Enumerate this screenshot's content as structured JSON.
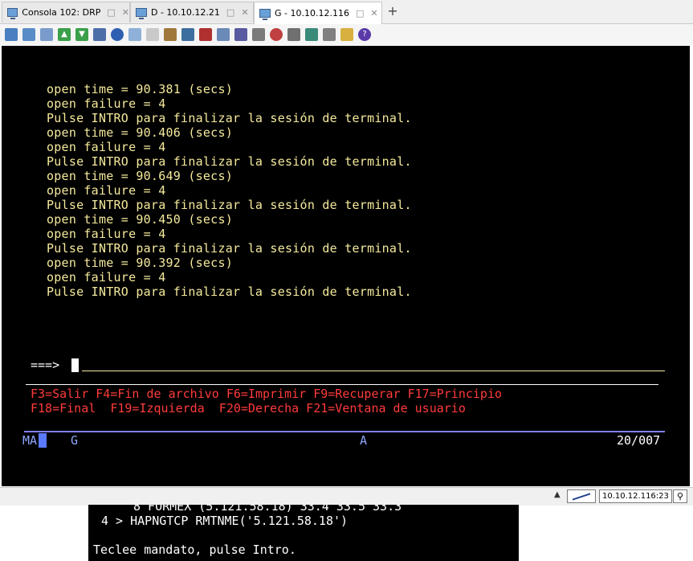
{
  "tabs": [
    {
      "label": "Consola 102: DRP",
      "active": false
    },
    {
      "label": "D - 10.10.12.21",
      "active": false
    },
    {
      "label": "G - 10.10.12.116",
      "active": true
    }
  ],
  "tab_controls": {
    "restore": "□",
    "close": "✕",
    "add": "+"
  },
  "toolbar_icons": [
    "copy-icon",
    "paste-icon",
    "clipboard-icon",
    "upload-icon",
    "download-icon",
    "disk-icon",
    "navigator-icon",
    "window-icon",
    "notes-icon",
    "package-icon",
    "settings-icon",
    "spool-icon",
    "mail-icon",
    "grid-icon",
    "macro-icon",
    "record-icon",
    "stop-icon",
    "play-icon",
    "pause-icon",
    "edit-icon",
    "help-icon"
  ],
  "terminal": {
    "lines": [
      "open time = 90.381 (secs)",
      "open failure = 4",
      "Pulse INTRO para finalizar la sesión de terminal.",
      "open time = 90.406 (secs)",
      "open failure = 4",
      "Pulse INTRO para finalizar la sesión de terminal.",
      "open time = 90.649 (secs)",
      "open failure = 4",
      "Pulse INTRO para finalizar la sesión de terminal.",
      "open time = 90.450 (secs)",
      "open failure = 4",
      "Pulse INTRO para finalizar la sesión de terminal.",
      "open time = 90.392 (secs)",
      "open failure = 4",
      "Pulse INTRO para finalizar la sesión de terminal."
    ],
    "prompt": "===>",
    "command_value": "",
    "fkeys_line1": "F3=Salir F4=Fin de archivo F6=Imprimir F9=Recuperar F17=Principio",
    "fkeys_line2": "F18=Final  F19=Izquierda  F20=Derecha F21=Ventana de usuario",
    "status": {
      "mode": "MA",
      "group": "G",
      "indicator": "A",
      "position": "20/007"
    }
  },
  "statusbar": {
    "arrow": "▲",
    "host": "10.10.12.116:23",
    "grip": "⚲"
  },
  "background_window": {
    "line1": "8 FORMEX (5.121.58.18) 33.4 33.5 33.3",
    "line2": "4 > HAPNGTCP RMTNME('5.121.58.18')",
    "line3": "Teclee mandato, pulse Intro."
  },
  "colors": {
    "terminal_bg": "#000000",
    "text_yellow": "#f5ea9c",
    "fkey_red": "#ff3b3b",
    "status_blue": "#8ea6ff"
  }
}
